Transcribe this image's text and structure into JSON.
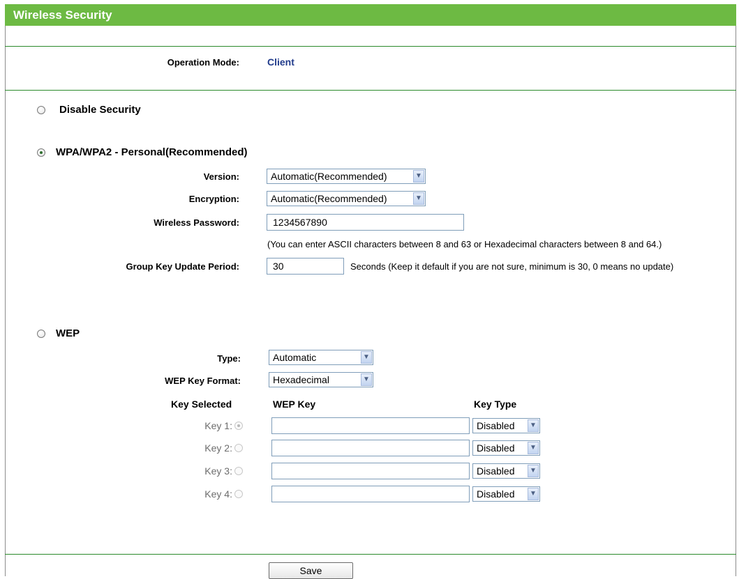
{
  "title": "Wireless Security",
  "operation_mode": {
    "label": "Operation Mode:",
    "value": "Client"
  },
  "disable_security": {
    "label": "Disable Security",
    "checked": false
  },
  "wpa": {
    "label": "WPA/WPA2 - Personal(Recommended)",
    "checked": true,
    "version_label": "Version:",
    "version_value": "Automatic(Recommended)",
    "encryption_label": "Encryption:",
    "encryption_value": "Automatic(Recommended)",
    "password_label": "Wireless Password:",
    "password_value": "1234567890",
    "password_hint": "(You can enter ASCII characters between 8 and 63 or Hexadecimal characters between 8 and 64.)",
    "group_key_label": "Group Key Update Period:",
    "group_key_value": "30",
    "group_key_hint": "Seconds (Keep it default if you are not sure, minimum is 30, 0 means no update)"
  },
  "wep": {
    "label": "WEP",
    "checked": false,
    "type_label": "Type:",
    "type_value": "Automatic",
    "format_label": "WEP Key Format:",
    "format_value": "Hexadecimal",
    "col_key_selected": "Key Selected",
    "col_wep_key": "WEP Key",
    "col_key_type": "Key Type",
    "keys": [
      {
        "label": "Key 1:",
        "selected": true,
        "value": "",
        "type": "Disabled"
      },
      {
        "label": "Key 2:",
        "selected": false,
        "value": "",
        "type": "Disabled"
      },
      {
        "label": "Key 3:",
        "selected": false,
        "value": "",
        "type": "Disabled"
      },
      {
        "label": "Key 4:",
        "selected": false,
        "value": "",
        "type": "Disabled"
      }
    ]
  },
  "save_label": "Save",
  "colors": {
    "title_bar": "#6dba43",
    "divider": "#2b8a2b",
    "mode_value": "#223c8c"
  },
  "icons": {
    "dropdown": "chevron-down-icon",
    "radio": "radio-icon"
  }
}
